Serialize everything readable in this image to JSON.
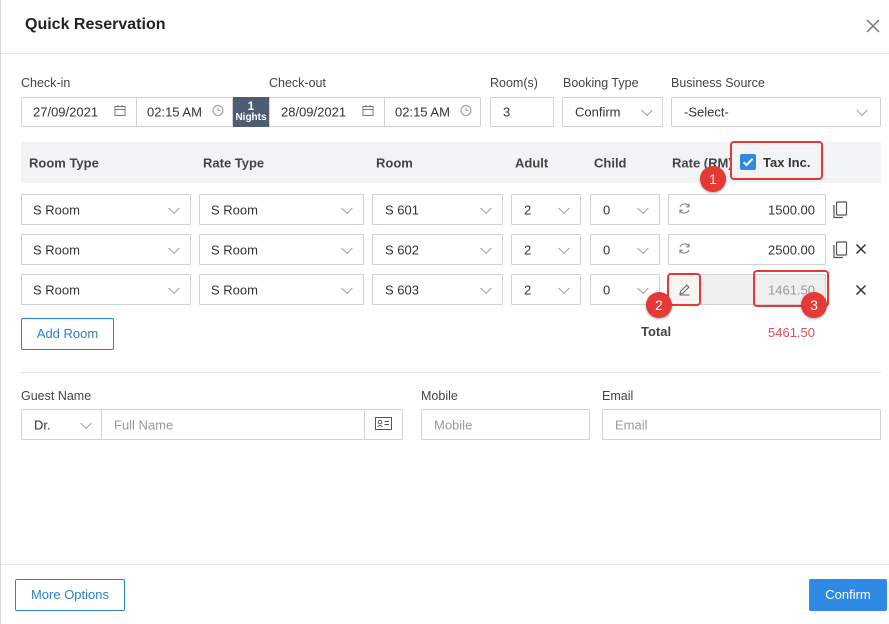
{
  "dialog": {
    "title": "Quick Reservation"
  },
  "dates": {
    "checkin_label": "Check-in",
    "checkin_date": "27/09/2021",
    "checkin_time": "02:15 AM",
    "nights_count": "1",
    "nights_label": "Nights",
    "checkout_label": "Check-out",
    "checkout_date": "28/09/2021",
    "checkout_time": "02:15 AM",
    "rooms_label": "Room(s)",
    "rooms_value": "3",
    "booking_type_label": "Booking Type",
    "booking_type_value": "Confirm",
    "business_source_label": "Business Source",
    "business_source_value": "-Select-"
  },
  "table": {
    "headers": {
      "room_type": "Room Type",
      "rate_type": "Rate Type",
      "room": "Room",
      "adult": "Adult",
      "child": "Child",
      "rate": "Rate (RM)",
      "tax_inc": "Tax Inc."
    },
    "rows": [
      {
        "room_type": "S Room",
        "rate_type": "S Room",
        "room": "S 601",
        "adult": "2",
        "child": "0",
        "rate": "1500.00"
      },
      {
        "room_type": "S Room",
        "rate_type": "S Room",
        "room": "S 602",
        "adult": "2",
        "child": "0",
        "rate": "2500.00"
      },
      {
        "room_type": "S Room",
        "rate_type": "S Room",
        "room": "S 603",
        "adult": "2",
        "child": "0",
        "rate": "1461.50"
      }
    ],
    "add_room_label": "Add Room",
    "total_label": "Total",
    "total_value": "5461.50"
  },
  "annotations": [
    "1",
    "2",
    "3"
  ],
  "guest": {
    "name_label": "Guest Name",
    "salutation": "Dr.",
    "fullname_placeholder": "Full Name",
    "mobile_label": "Mobile",
    "mobile_placeholder": "Mobile",
    "email_label": "Email",
    "email_placeholder": "Email"
  },
  "footer": {
    "more_options_label": "More Options",
    "confirm_label": "Confirm"
  },
  "icons": {
    "calendar": "calendar-icon",
    "clock": "clock-icon",
    "refresh": "refresh-icon",
    "copy": "copy-icon",
    "edit": "pencil-icon",
    "id_card": "id-card-icon",
    "close": "close-icon"
  },
  "colors": {
    "primary": "#2f8ae5",
    "annotation": "#e53935",
    "total": "#e0505a",
    "nights_badge": "#4d5e74"
  }
}
